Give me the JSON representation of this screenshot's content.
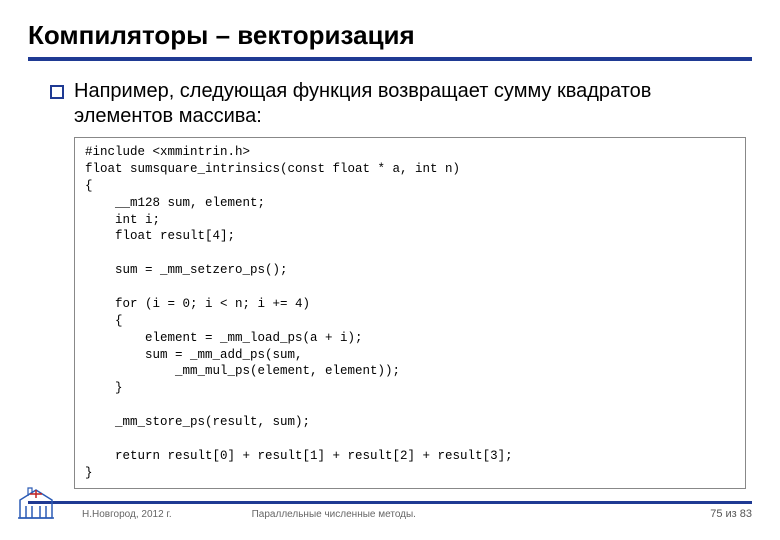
{
  "title": "Компиляторы – векторизация",
  "bullet_text": "Например, следующая функция возвращает сумму квадратов элементов массива:",
  "code": "#include <xmmintrin.h>\nfloat sumsquare_intrinsics(const float * a, int n)\n{\n    __m128 sum, element;\n    int i;\n    float result[4];\n\n    sum = _mm_setzero_ps();\n\n    for (i = 0; i < n; i += 4)\n    {\n        element = _mm_load_ps(a + i);\n        sum = _mm_add_ps(sum,\n            _mm_mul_ps(element, element));\n    }\n\n    _mm_store_ps(result, sum);\n\n    return result[0] + result[1] + result[2] + result[3];\n}",
  "footer": {
    "location": "Н.Новгород, 2012 г.",
    "subject": "Параллельные численные методы.",
    "page": "75 из 83"
  },
  "colors": {
    "accent": "#1f3a93"
  }
}
